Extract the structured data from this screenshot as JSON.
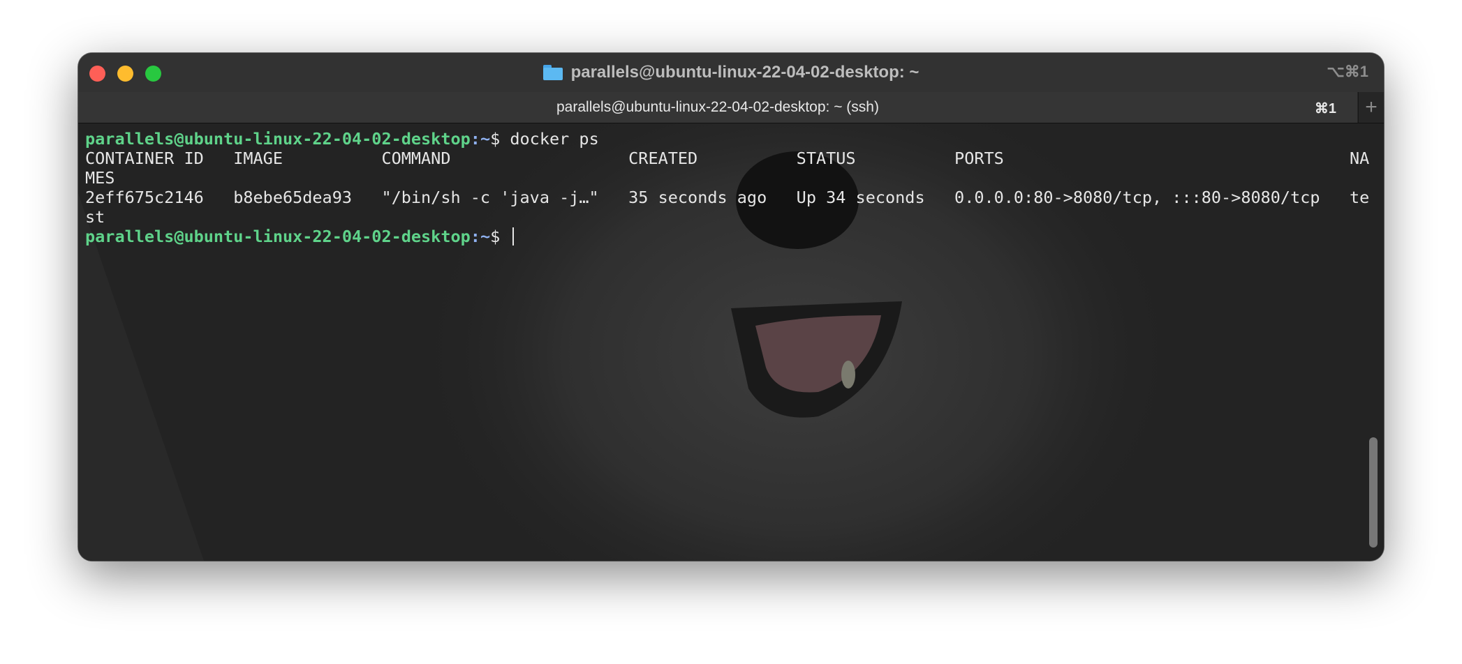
{
  "window": {
    "title": "parallels@ubuntu-linux-22-04-02-desktop: ~",
    "title_shortcut": "⌥⌘1"
  },
  "tab": {
    "label": "parallels@ubuntu-linux-22-04-02-desktop: ~ (ssh)",
    "shortcut": "⌘1",
    "new_tab_label": "+"
  },
  "terminal": {
    "prompt_user": "parallels@ubuntu-linux-22-04-02-desktop",
    "prompt_sep": ":",
    "prompt_path": "~",
    "prompt_symbol": "$ ",
    "command": "docker ps",
    "header_line": "CONTAINER ID   IMAGE          COMMAND                  CREATED          STATUS          PORTS                                   NA",
    "header_wrap": "MES",
    "row_line": "2eff675c2146   b8ebe65dea93   \"/bin/sh -c 'java -j…\"   35 seconds ago   Up 34 seconds   0.0.0.0:80->8080/tcp, :::80->8080/tcp   te",
    "row_wrap": "st"
  },
  "icons": {
    "folder": "folder-icon",
    "close": "close-icon",
    "minimize": "minimize-icon",
    "maximize": "maximize-icon",
    "new_tab": "plus-icon"
  },
  "colors": {
    "prompt_user": "#5fd38a",
    "prompt_path": "#8fb1f0",
    "text": "#e6e6e6",
    "close": "#fe5f57",
    "minimize": "#febc2e",
    "maximize": "#28c840"
  }
}
